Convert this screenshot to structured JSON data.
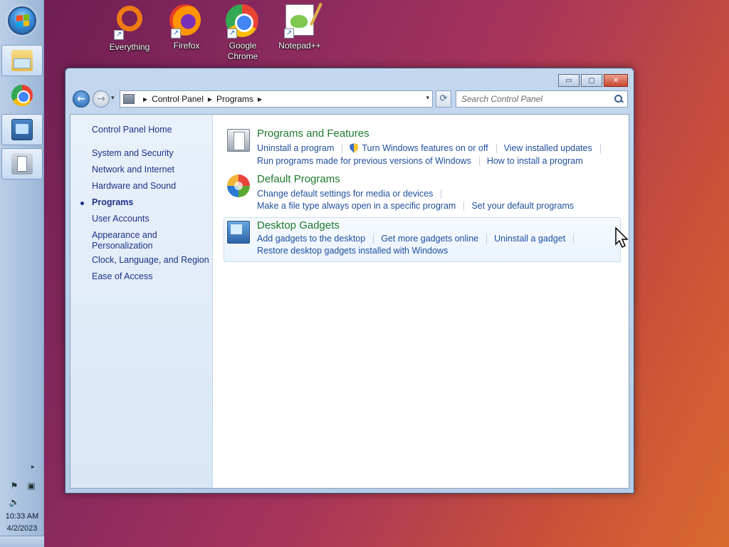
{
  "desktop": {
    "icons": [
      {
        "label": "Everything",
        "icon": "everything-icon"
      },
      {
        "label": "Firefox",
        "icon": "firefox-icon"
      },
      {
        "label": "Google Chrome",
        "icon": "chrome-icon"
      },
      {
        "label": "Notepad++",
        "icon": "notepad-plus-plus-icon"
      }
    ]
  },
  "taskbar": {
    "start": "start-orb-icon",
    "pinned": [
      {
        "name": "windows-explorer-icon"
      },
      {
        "name": "chrome-icon"
      },
      {
        "name": "control-panel-icon"
      },
      {
        "name": "programs-icon"
      }
    ],
    "tray": {
      "expand_glyph": "▸",
      "action_center_icon": "action-center-flag-icon",
      "network_icon": "network-icon",
      "volume_icon": "volume-muted-icon"
    },
    "clock": {
      "time": "10:33 AM",
      "date": "4/2/2023"
    }
  },
  "window": {
    "controls": {
      "minimize": "▭",
      "maximize": "▢",
      "close": "✕"
    },
    "navigation": {
      "back_glyph": "←",
      "forward_glyph": "→",
      "dropdown_glyph": "▾",
      "refresh_glyph": "⟳"
    },
    "address": {
      "breadcrumbs": [
        "Control Panel",
        "Programs"
      ],
      "separator": "▶"
    },
    "search": {
      "placeholder": "Search Control Panel"
    },
    "left_nav": {
      "home": "Control Panel Home",
      "items": [
        {
          "label": "System and Security",
          "current": false
        },
        {
          "label": "Network and Internet",
          "current": false
        },
        {
          "label": "Hardware and Sound",
          "current": false
        },
        {
          "label": "Programs",
          "current": true
        },
        {
          "label": "User Accounts",
          "current": false
        },
        {
          "label": "Appearance and\nPersonalization",
          "current": false
        },
        {
          "label": "Clock, Language, and Region",
          "current": false
        },
        {
          "label": "Ease of Access",
          "current": false
        }
      ]
    },
    "categories": [
      {
        "title": "Programs and Features",
        "icon": "programs-and-features-icon",
        "rows": [
          [
            "Uninstall a program",
            "Turn Windows features on or off",
            "View installed updates"
          ],
          [
            "Run programs made for previous versions of Windows",
            "How to install a program"
          ]
        ]
      },
      {
        "title": "Default Programs",
        "icon": "default-programs-icon",
        "rows": [
          [
            "Change default settings for media or devices"
          ],
          [
            "Make a file type always open in a specific program",
            "Set your default programs"
          ]
        ]
      },
      {
        "title": "Desktop Gadgets",
        "icon": "desktop-gadgets-icon",
        "rows": [
          [
            "Add gadgets to the desktop",
            "Get more gadgets online",
            "Uninstall a gadget"
          ],
          [
            "Restore desktop gadgets installed with Windows"
          ]
        ]
      }
    ]
  }
}
